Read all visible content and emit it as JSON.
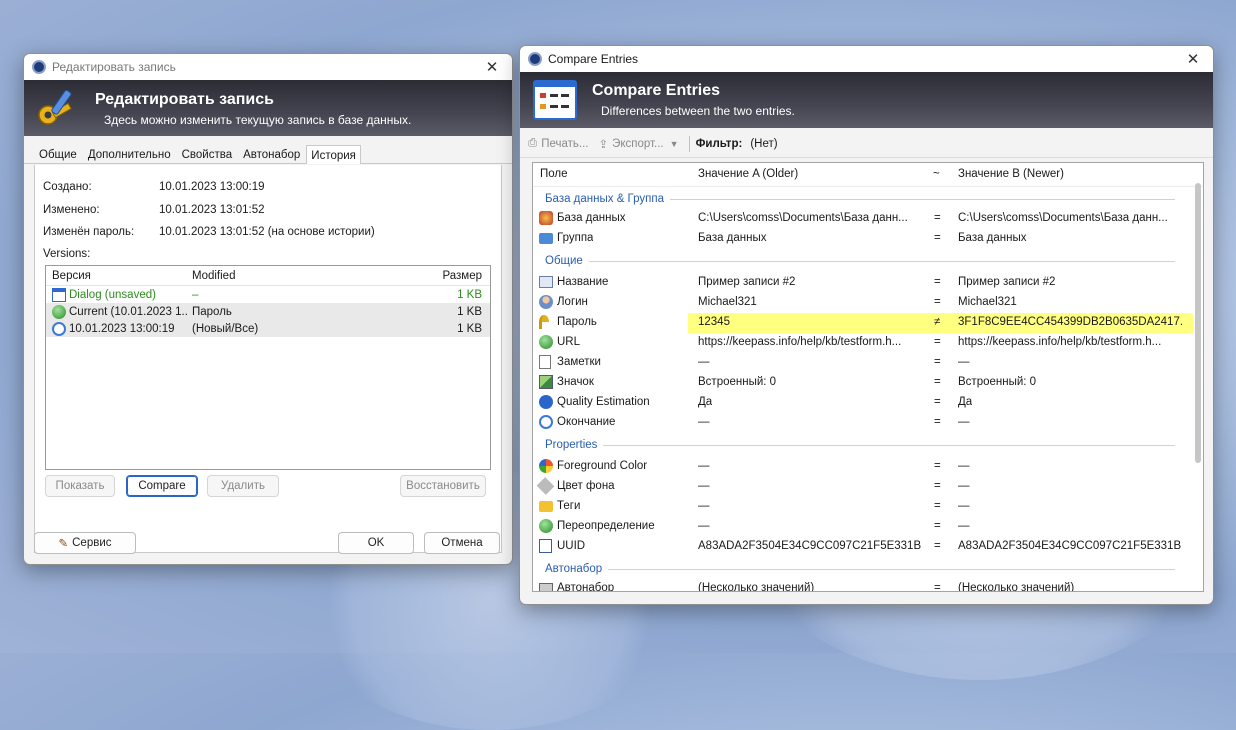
{
  "edit_window": {
    "title": "Редактировать запись",
    "banner_title": "Редактировать запись",
    "banner_subtitle": "Здесь можно изменить текущую запись в базе данных.",
    "tabs": [
      "Общие",
      "Дополнительно",
      "Свойства",
      "Автонабор",
      "История"
    ],
    "active_tab": "История",
    "fields": [
      {
        "label": "Создано:",
        "value": "10.01.2023 13:00:19"
      },
      {
        "label": "Изменено:",
        "value": "10.01.2023 13:01:52"
      },
      {
        "label": "Изменён пароль:",
        "value": "10.01.2023 13:01:52 (на основе истории)"
      }
    ],
    "versions_label": "Versions:",
    "versions_columns": [
      "Версия",
      "Modified",
      "Размер"
    ],
    "versions": [
      {
        "version": "Dialog (unsaved)",
        "modified": "–",
        "size": "1 KB",
        "icon": "dialog-icon",
        "color": "#2e8b1f"
      },
      {
        "version": "Current (10.01.2023 1...",
        "modified": "Пароль",
        "size": "1 KB",
        "icon": "current-globe-icon",
        "color": "#1a1a1a"
      },
      {
        "version": "10.01.2023 13:00:19",
        "modified": "(Новый/Все)",
        "size": "1 KB",
        "icon": "clock-icon",
        "color": "#1a1a1a"
      }
    ],
    "buttons": {
      "show": "Показать",
      "compare": "Compare",
      "delete": "Удалить",
      "restore": "Восстановить",
      "tools": "Сервис",
      "ok": "OK",
      "cancel": "Отмена"
    }
  },
  "compare_window": {
    "title": "Compare Entries",
    "banner_title": "Compare Entries",
    "banner_subtitle": "Differences between the two entries.",
    "toolbar": {
      "print": "Печать...",
      "export": "Экспорт...",
      "filter_label": "Фильтр:",
      "filter_value": "(Нет)"
    },
    "columns": [
      "Поле",
      "Значение A (Older)",
      "~",
      "Значение B (Newer)"
    ],
    "groups": [
      {
        "title": "База данных & Группа",
        "rows": [
          {
            "field": "База данных",
            "icon": "database-icon",
            "a": "C:\\Users\\comss\\Documents\\База данн...",
            "op": "=",
            "b": "C:\\Users\\comss\\Documents\\База данн..."
          },
          {
            "field": "Группа",
            "icon": "folder-icon",
            "a": "База данных",
            "op": "=",
            "b": "База данных"
          }
        ]
      },
      {
        "title": "Общие",
        "rows": [
          {
            "field": "Название",
            "icon": "title-icon",
            "a": "Пример записи #2",
            "op": "=",
            "b": "Пример записи #2"
          },
          {
            "field": "Логин",
            "icon": "user-icon",
            "a": "Michael321",
            "op": "=",
            "b": "Michael321"
          },
          {
            "field": "Пароль",
            "icon": "key-icon",
            "a": "12345",
            "op": "≠",
            "b": "3F1F8C9EE4CC454399DB2B0635DA2417...",
            "highlight": true
          },
          {
            "field": "URL",
            "icon": "globe-icon",
            "a": "https://keepass.info/help/kb/testform.h...",
            "op": "=",
            "b": "https://keepass.info/help/kb/testform.h..."
          },
          {
            "field": "Заметки",
            "icon": "notes-icon",
            "a": "—",
            "op": "=",
            "b": "—"
          },
          {
            "field": "Значок",
            "icon": "image-icon",
            "a": "Встроенный: 0",
            "op": "=",
            "b": "Встроенный: 0"
          },
          {
            "field": "Quality Estimation",
            "icon": "info-icon",
            "a": "Да",
            "op": "=",
            "b": "Да"
          },
          {
            "field": "Окончание",
            "icon": "expiry-clock-icon",
            "a": "—",
            "op": "=",
            "b": "—"
          }
        ]
      },
      {
        "title": "Properties",
        "rows": [
          {
            "field": "Foreground Color",
            "icon": "palette-icon",
            "a": "—",
            "op": "=",
            "b": "—"
          },
          {
            "field": "Цвет фона",
            "icon": "paint-bucket-icon",
            "a": "—",
            "op": "=",
            "b": "—"
          },
          {
            "field": "Теги",
            "icon": "tag-folder-icon",
            "a": "—",
            "op": "=",
            "b": "—"
          },
          {
            "field": "Переопределение",
            "icon": "override-icon",
            "a": "—",
            "op": "=",
            "b": "—"
          },
          {
            "field": "UUID",
            "icon": "uuid-icon",
            "a": "A83ADA2F3504E34C9CC097C21F5E331B",
            "op": "=",
            "b": "A83ADA2F3504E34C9CC097C21F5E331B"
          }
        ]
      },
      {
        "title": "Автонабор",
        "rows": [
          {
            "field": "Автонабор",
            "icon": "keyboard-icon",
            "a": "(Несколько значений)",
            "op": "=",
            "b": "(Несколько значений)"
          }
        ]
      }
    ]
  },
  "colors": {
    "accent": "#2a66c9",
    "group_header": "#2a5db0",
    "highlight": "#ffff80",
    "unsaved_green": "#2e8b1f"
  }
}
